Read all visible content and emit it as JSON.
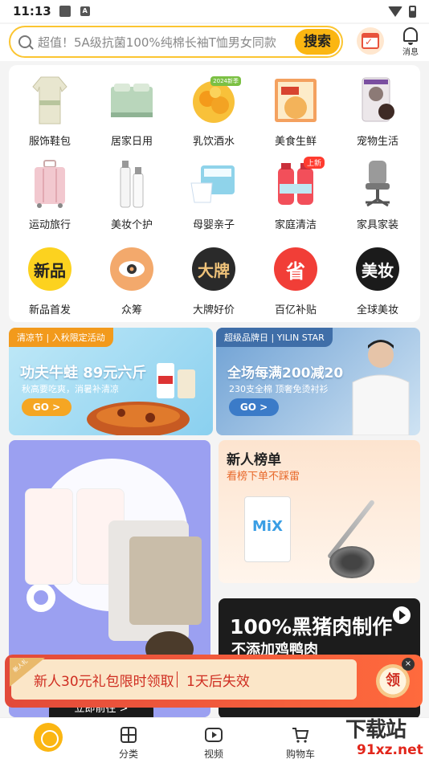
{
  "status": {
    "time": "11:13",
    "notif_letter": "A"
  },
  "search": {
    "placeholder": "超值！5A级抗菌100%纯棉长袖T恤男女同款",
    "button": "搜索"
  },
  "header": {
    "message_label": "消息"
  },
  "categories": [
    {
      "label": "服饰鞋包",
      "icon": "clothing-icon"
    },
    {
      "label": "居家日用",
      "icon": "bedding-icon"
    },
    {
      "label": "乳饮酒水",
      "icon": "fruit-icon",
      "tag": "2024新季"
    },
    {
      "label": "美食生鲜",
      "icon": "food-icon"
    },
    {
      "label": "宠物生活",
      "icon": "pet-food-icon"
    },
    {
      "label": "运动旅行",
      "icon": "suitcase-icon"
    },
    {
      "label": "美妆个护",
      "icon": "cosmetics-icon"
    },
    {
      "label": "母婴亲子",
      "icon": "diaper-icon"
    },
    {
      "label": "家庭清洁",
      "icon": "cleaning-icon",
      "tag": "上新"
    },
    {
      "label": "家具家装",
      "icon": "chair-icon"
    },
    {
      "label": "新品首发",
      "icon": "new-product-icon",
      "badge": "新品",
      "color": "#fcd21f",
      "text_color": "#222"
    },
    {
      "label": "众筹",
      "icon": "crowdfund-icon",
      "color": "#f3a96c"
    },
    {
      "label": "大牌好价",
      "icon": "big-brand-icon",
      "badge": "大牌",
      "color": "#2a2a2a",
      "text_color": "#f0c37a"
    },
    {
      "label": "百亿补贴",
      "icon": "subsidy-icon",
      "badge": "省",
      "color": "#f13e37",
      "text_color": "#fff"
    },
    {
      "label": "全球美妆",
      "icon": "global-beauty-icon",
      "badge": "美妆",
      "color": "#1b1b1b",
      "text_color": "#fff"
    }
  ],
  "banners": [
    {
      "tag": "清凉节 | 入秋限定活动",
      "title": "功夫牛蛙 89元六斤",
      "subtitle": "秋高要吃爽，消暑补清凉",
      "cta": "GO >",
      "tag_color": "#f29a1c",
      "cta_color": "#f5a623"
    },
    {
      "tag": "超级品牌日 | YILIN STAR",
      "title": "全场每满200减20",
      "subtitle": "230支全棉 顶奢免烫衬衫",
      "cta": "GO >",
      "tag_color": "#3f6ea8",
      "cta_color": "#3b7bc8"
    }
  ],
  "new_rank": {
    "title": "新人榜单",
    "subtitle": "看榜下单不踩雷",
    "box_text": "MiX"
  },
  "pork": {
    "line1": "100%黑猪肉制作",
    "line2": "不添加鸡鸭肉"
  },
  "promo_left": {
    "button": "立即前往 >"
  },
  "coupon": {
    "ribbon": "新人礼",
    "text": "新人30元礼包限时领取",
    "expire": "1天后失效",
    "claim": "领",
    "close": "×"
  },
  "nav": [
    {
      "label": "",
      "icon": "home-icon"
    },
    {
      "label": "分类",
      "icon": "category-icon"
    },
    {
      "label": "视频",
      "icon": "video-icon"
    },
    {
      "label": "购物车",
      "icon": "cart-icon"
    }
  ],
  "watermark": {
    "title": "下载站",
    "url": "91xz.net"
  }
}
